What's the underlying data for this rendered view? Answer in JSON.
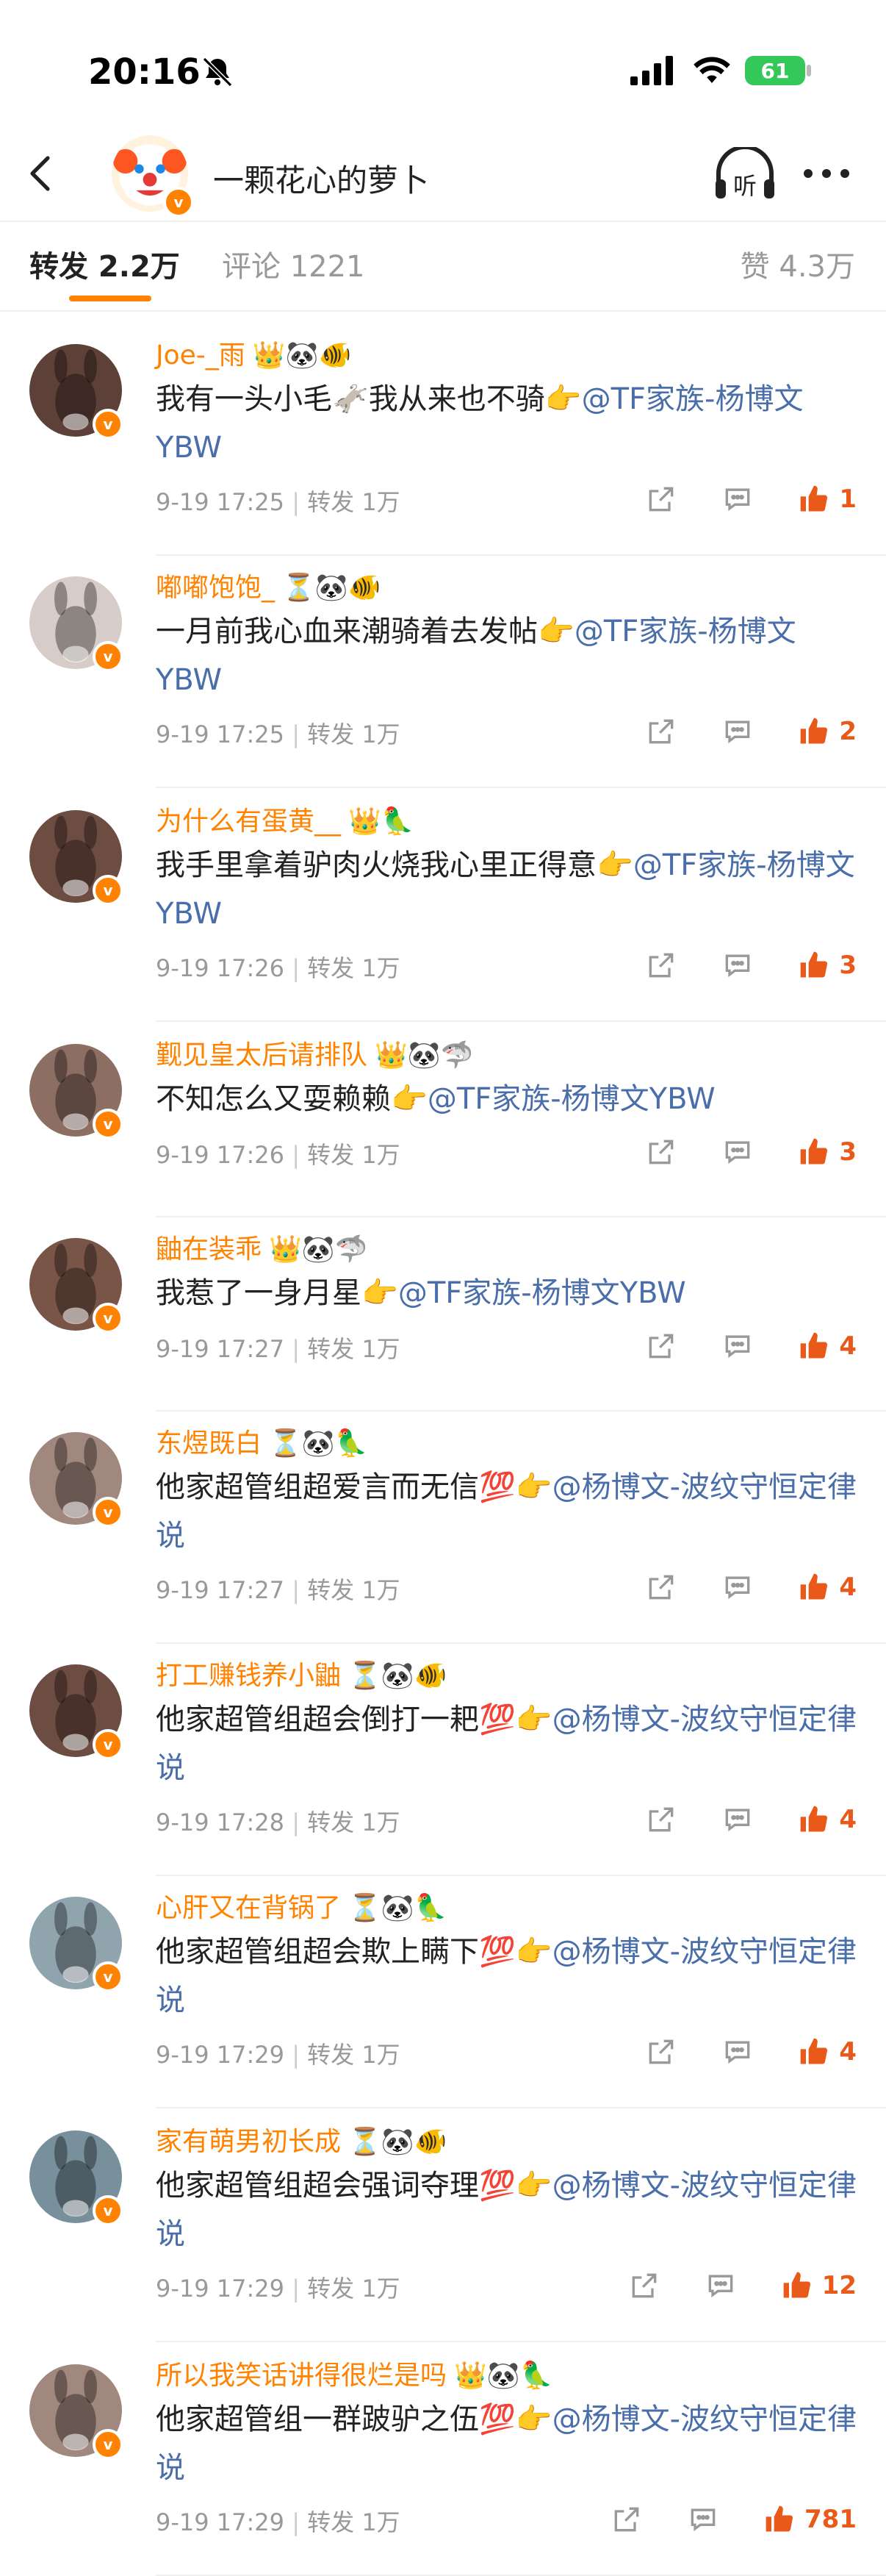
{
  "status_bar": {
    "time": "20:16",
    "battery": "61"
  },
  "header": {
    "title": "一颗花心的萝卜",
    "listen_label": "听"
  },
  "tabs": {
    "reposts": "转发 2.2万",
    "comments": "评论 1221",
    "likes": "赞 4.3万"
  },
  "accent_color": "#ff8200",
  "mention_color": "#4a6ea9",
  "reposts": [
    {
      "name": "Joe-_雨",
      "badges": "👑🐼🐠",
      "text": "我有一头小毛🫏我从来也不骑👉",
      "mention": "@TF家族-杨博文YBW",
      "time": "9-19 17:25",
      "repost": "转发 1万",
      "likes": "1"
    },
    {
      "name": "嘟嘟饱饱_",
      "badges": "⏳🐼🐠",
      "text": "一月前我心血来潮骑着去发帖👉",
      "mention": "@TF家族-杨博文YBW",
      "time": "9-19 17:25",
      "repost": "转发 1万",
      "likes": "2"
    },
    {
      "name": "为什么有蛋黄__",
      "badges": "👑🦜",
      "text": "我手里拿着驴肉火烧我心里正得意👉",
      "mention": "@TF家族-杨博文YBW",
      "time": "9-19 17:26",
      "repost": "转发 1万",
      "likes": "3"
    },
    {
      "name": "觐见皇太后请排队",
      "badges": "👑🐼🦈",
      "text": "不知怎么又耍赖赖👉",
      "mention": "@TF家族-杨博文YBW",
      "time": "9-19 17:26",
      "repost": "转发 1万",
      "likes": "3"
    },
    {
      "name": "鼬在装乖",
      "badges": "👑🐼🦈",
      "text": "我惹了一身月星👉",
      "mention": "@TF家族-杨博文YBW",
      "time": "9-19 17:27",
      "repost": "转发 1万",
      "likes": "4"
    },
    {
      "name": "东煜既白",
      "badges": "⏳🐼🦜",
      "text": "他家超管组超爱言而无信💯👉",
      "mention": "@杨博文-波纹守恒定律说",
      "time": "9-19 17:27",
      "repost": "转发 1万",
      "likes": "4"
    },
    {
      "name": "打工赚钱养小鼬",
      "badges": "⏳🐼🐠",
      "text": "他家超管组超会倒打一耙💯👉",
      "mention": "@杨博文-波纹守恒定律说",
      "time": "9-19 17:28",
      "repost": "转发 1万",
      "likes": "4"
    },
    {
      "name": "心肝又在背锅了",
      "badges": "⏳🐼🦜",
      "text": "他家超管组超会欺上瞒下💯👉",
      "mention": "@杨博文-波纹守恒定律说",
      "time": "9-19 17:29",
      "repost": "转发 1万",
      "likes": "4"
    },
    {
      "name": "家有萌男初长成",
      "badges": "⏳🐼🐠",
      "text": "他家超管组超会强词夺理💯👉",
      "mention": "@杨博文-波纹守恒定律说",
      "time": "9-19 17:29",
      "repost": "转发 1万",
      "likes": "12"
    },
    {
      "name": "所以我笑话讲得很烂是吗",
      "badges": "👑🐼🦜",
      "text": "他家超管组一群跛驴之伍💯👉",
      "mention": "@杨博文-波纹守恒定律说",
      "time": "9-19 17:29",
      "repost": "转发 1万",
      "likes": "781"
    }
  ]
}
